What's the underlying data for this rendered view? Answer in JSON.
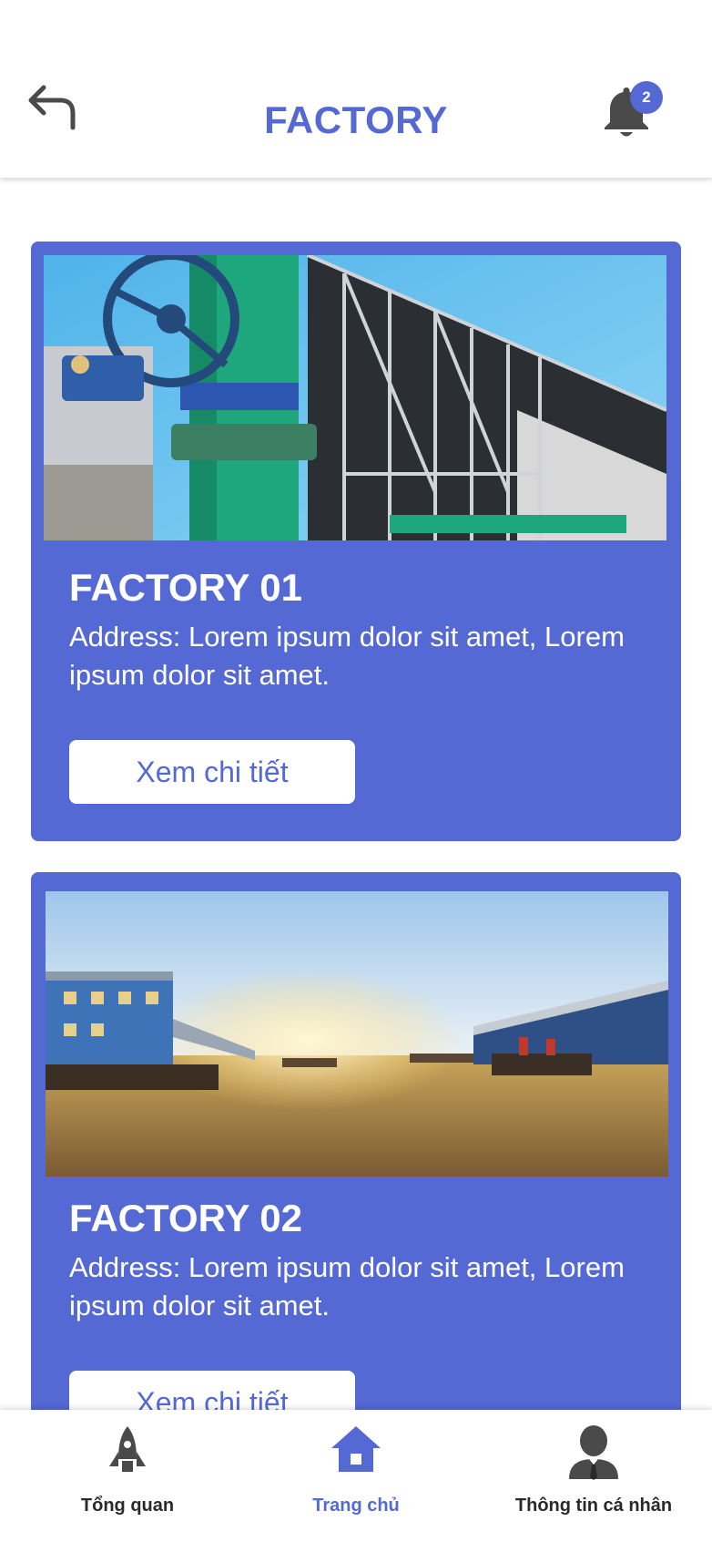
{
  "header": {
    "title": "FACTORY",
    "notification_count": "2",
    "accent_color": "#5469d4"
  },
  "factories": [
    {
      "name": "FACTORY 01",
      "address": "Address: Lorem ipsum dolor sit amet, Lorem ipsum dolor sit amet.",
      "button_label": "Xem chi tiết",
      "image": "industrial cooling tower with green valve pipe"
    },
    {
      "name": "FACTORY 02",
      "address": "Address: Lorem ipsum dolor sit amet, Lorem ipsum dolor sit amet.",
      "button_label": "Xem chi tiết",
      "image": "industrial harbor with barges at sunset"
    }
  ],
  "tabbar": {
    "tabs": [
      {
        "label": "Tổng quan",
        "icon": "rocket-icon",
        "active": false
      },
      {
        "label": "Trang chủ",
        "icon": "home-icon",
        "active": true
      },
      {
        "label": "Thông tin cá nhân",
        "icon": "user-icon",
        "active": false
      }
    ]
  }
}
